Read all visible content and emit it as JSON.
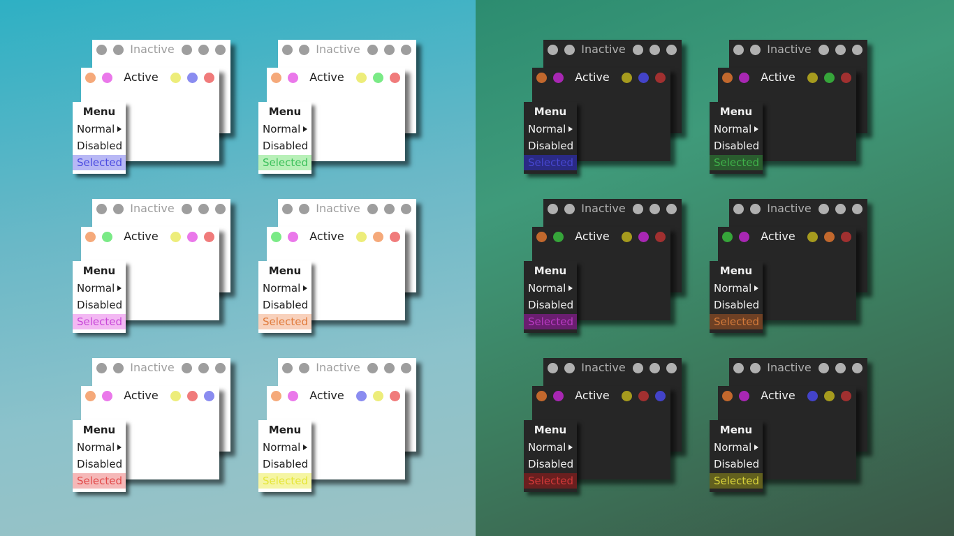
{
  "labels": {
    "inactive_title": "Inactive",
    "active_title": "Active",
    "menu_header": "Menu",
    "menu_normal": "Normal",
    "menu_disabled": "Disabled",
    "menu_selected": "Selected"
  },
  "light_palette": {
    "orange": "#f5a97a",
    "magenta": "#ea78ea",
    "yellow": "#eded7a",
    "blue": "#8a8cf0",
    "red": "#f07b7b",
    "green": "#7aea86"
  },
  "dark_palette": {
    "orange": "#c2682d",
    "magenta": "#a827b3",
    "yellow": "#a69b1e",
    "blue": "#4343c9",
    "red": "#a13030",
    "green": "#36a53a"
  },
  "variants": [
    {
      "theme": "light",
      "buttons": [
        "orange",
        "magenta",
        "yellow",
        "blue",
        "red"
      ],
      "selected": {
        "bg": "#b8b8f5",
        "fg": "#4a4ae0"
      }
    },
    {
      "theme": "light",
      "buttons": [
        "orange",
        "magenta",
        "yellow",
        "green",
        "red"
      ],
      "selected": {
        "bg": "#b8f0b8",
        "fg": "#3cc05a"
      }
    },
    {
      "theme": "light",
      "buttons": [
        "orange",
        "green",
        "yellow",
        "magenta",
        "red"
      ],
      "selected": {
        "bg": "#f3b8f3",
        "fg": "#c846d8"
      }
    },
    {
      "theme": "light",
      "buttons": [
        "green",
        "magenta",
        "yellow",
        "orange",
        "red"
      ],
      "selected": {
        "bg": "#f8d1bc",
        "fg": "#e07a3a"
      }
    },
    {
      "theme": "light",
      "buttons": [
        "orange",
        "magenta",
        "yellow",
        "red",
        "blue"
      ],
      "selected": {
        "bg": "#f5b8b8",
        "fg": "#e24a4a"
      }
    },
    {
      "theme": "light",
      "buttons": [
        "orange",
        "magenta",
        "blue",
        "yellow",
        "red"
      ],
      "selected": {
        "bg": "#f5f5a3",
        "fg": "#e6e63a"
      }
    },
    {
      "theme": "dark",
      "buttons": [
        "orange",
        "magenta",
        "yellow",
        "blue",
        "red"
      ],
      "selected": {
        "bg": "#2a2a85",
        "fg": "#4646d0"
      }
    },
    {
      "theme": "dark",
      "buttons": [
        "orange",
        "magenta",
        "yellow",
        "green",
        "red"
      ],
      "selected": {
        "bg": "#2a5c2e",
        "fg": "#3fb24a"
      }
    },
    {
      "theme": "dark",
      "buttons": [
        "orange",
        "green",
        "yellow",
        "magenta",
        "red"
      ],
      "selected": {
        "bg": "#6a1e70",
        "fg": "#b93ac3"
      }
    },
    {
      "theme": "dark",
      "buttons": [
        "green",
        "magenta",
        "yellow",
        "orange",
        "red"
      ],
      "selected": {
        "bg": "#6e4024",
        "fg": "#d47a3a"
      }
    },
    {
      "theme": "dark",
      "buttons": [
        "orange",
        "magenta",
        "yellow",
        "red",
        "blue"
      ],
      "selected": {
        "bg": "#6a1f1f",
        "fg": "#d23838"
      }
    },
    {
      "theme": "dark",
      "buttons": [
        "orange",
        "magenta",
        "blue",
        "yellow",
        "red"
      ],
      "selected": {
        "bg": "#62601e",
        "fg": "#d8d23a"
      }
    }
  ]
}
